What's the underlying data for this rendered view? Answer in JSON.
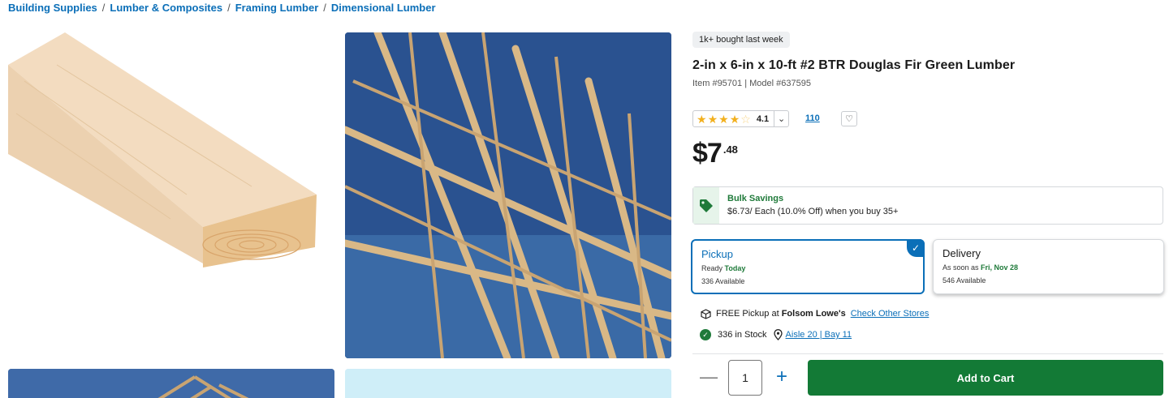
{
  "breadcrumb": {
    "items": [
      "Building Supplies",
      "Lumber & Composites",
      "Framing Lumber",
      "Dimensional Lumber"
    ],
    "separator": "/"
  },
  "product": {
    "badge": "1k+ bought last week",
    "title": "2-in x 6-in x 10-ft #2 BTR Douglas Fir Green Lumber",
    "meta": "Item #95701 | Model #637595",
    "rating": {
      "value": "4.1",
      "stars": 4.1,
      "max": 5,
      "review_count": "110"
    },
    "price": {
      "dollars": "$7",
      "cents": ".48"
    }
  },
  "bulk": {
    "title": "Bulk Savings",
    "desc": "$6.73/ Each (10.0% Off) when you buy 35+"
  },
  "fulfillment": {
    "pickup": {
      "title": "Pickup",
      "line1_prefix": "Ready",
      "line1_value": "Today",
      "line2": "336 Available",
      "selected": true
    },
    "delivery": {
      "title": "Delivery",
      "line1_prefix": "As soon as",
      "line1_value": "Fri, Nov 28",
      "line2": "546 Available",
      "selected": false
    }
  },
  "store": {
    "prefix": "FREE Pickup at",
    "store_name": "Folsom Lowe's",
    "link": "Check Other Stores"
  },
  "stock": {
    "text": "336 in Stock",
    "location": "Aisle 20 | Bay 11"
  },
  "cart": {
    "quantity": "1",
    "minus": "—",
    "plus": "+",
    "add_label": "Add to Cart"
  },
  "colors": {
    "link": "#0b6fb8",
    "brand_green": "#137a36",
    "star": "#f2b01e"
  },
  "icons": [
    "tag-icon",
    "check-icon",
    "package-icon",
    "check-circle-icon",
    "location-pin-icon",
    "heart-icon",
    "chevron-down-icon",
    "minus-icon",
    "plus-icon"
  ]
}
